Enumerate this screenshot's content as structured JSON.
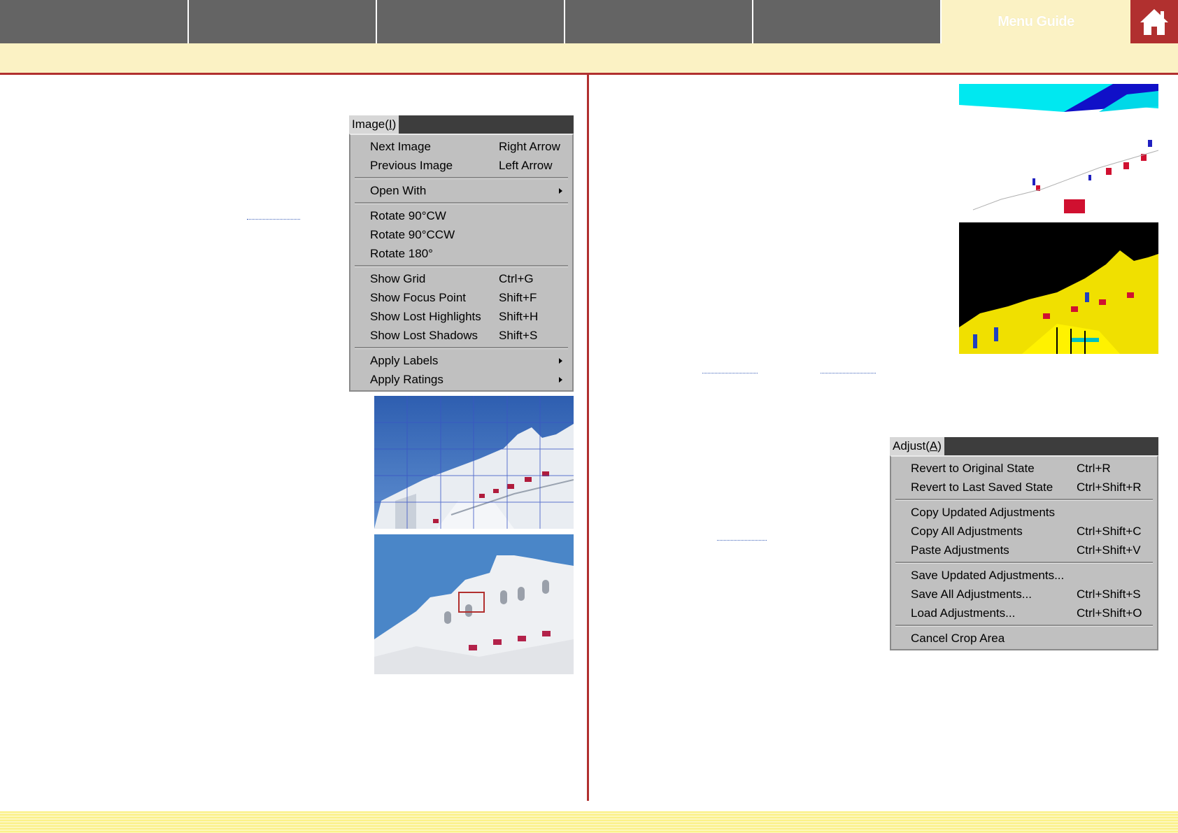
{
  "nav": {
    "active_label": "Menu Guide",
    "home_icon": "home-icon"
  },
  "image_menu": {
    "title": "Image(",
    "title_key": "I",
    "title_end": ")",
    "items": [
      {
        "label": "Next Image",
        "shortcut": "Right Arrow"
      },
      {
        "label": "Previous Image",
        "shortcut": "Left Arrow"
      },
      {
        "label": "Open With",
        "submenu": true
      },
      {
        "label": "Rotate 90°CW"
      },
      {
        "label": "Rotate 90°CCW"
      },
      {
        "label": "Rotate 180°"
      },
      {
        "label": "Show Grid",
        "shortcut": "Ctrl+G"
      },
      {
        "label": "Show Focus Point",
        "shortcut": "Shift+F"
      },
      {
        "label": "Show Lost Highlights",
        "shortcut": "Shift+H"
      },
      {
        "label": "Show Lost Shadows",
        "shortcut": "Shift+S"
      },
      {
        "label": "Apply Labels",
        "submenu": true
      },
      {
        "label": "Apply Ratings",
        "submenu": true
      }
    ]
  },
  "adjust_menu": {
    "title": "Adjust(",
    "title_key": "A",
    "title_end": ")",
    "items": [
      {
        "label": "Revert to Original State",
        "shortcut": "Ctrl+R"
      },
      {
        "label": "Revert to Last Saved State",
        "shortcut": "Ctrl+Shift+R"
      },
      {
        "label": "Copy Updated Adjustments"
      },
      {
        "label": "Copy All Adjustments",
        "shortcut": "Ctrl+Shift+C"
      },
      {
        "label": "Paste Adjustments",
        "shortcut": "Ctrl+Shift+V"
      },
      {
        "label": "Save Updated Adjustments..."
      },
      {
        "label": "Save All Adjustments...",
        "shortcut": "Ctrl+Shift+S"
      },
      {
        "label": "Load Adjustments...",
        "shortcut": "Ctrl+Shift+O"
      },
      {
        "label": "Cancel Crop Area"
      }
    ]
  },
  "colors": {
    "nav_gray": "#646464",
    "cream": "#fbf2c4",
    "accent_red": "#b1302f",
    "menu_gray": "#c0c0c0",
    "menu_bar_dark": "#3d3d3d"
  }
}
